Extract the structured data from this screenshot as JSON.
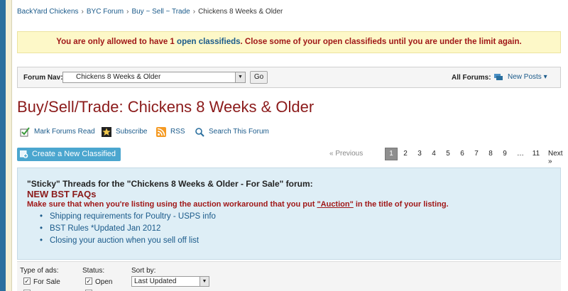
{
  "breadcrumb": {
    "items": [
      "BackYard Chickens",
      "BYC Forum",
      "Buy ~ Sell ~ Trade",
      "Chickens 8 Weeks & Older"
    ],
    "separator": "›"
  },
  "notice": {
    "prefix": "You are only allowed to have 1",
    "link": "open classifieds",
    "suffix": ". Close some of your open classifieds until you are under the limit again."
  },
  "forum_nav": {
    "label": "Forum Nav:",
    "selected": "Chickens 8 Weeks & Older",
    "go_label": "Go",
    "all_forums_label": "All Forums:",
    "new_posts_label": "New Posts"
  },
  "page_title": "Buy/Sell/Trade: Chickens 8 Weeks & Older",
  "tools": {
    "mark_read": "Mark Forums Read",
    "subscribe": "Subscribe",
    "rss": "RSS",
    "search": "Search This Forum"
  },
  "create_button": "Create a New Classified",
  "pagination": {
    "previous": "« Previous",
    "pages": [
      "1",
      "2",
      "3",
      "4",
      "5",
      "6",
      "7",
      "8",
      "9"
    ],
    "current": "1",
    "ellipsis": "…",
    "last": "11",
    "next": "Next »"
  },
  "sticky": {
    "header": "\"Sticky\" Threads for the \"Chickens 8 Weeks & Older - For Sale\" forum:",
    "subtitle": "NEW BST FAQs",
    "warning_prefix": "Make sure that when you're listing using the auction workaround that you put ",
    "warning_link": "\"Auction\"",
    "warning_suffix": " in the title of your listing.",
    "links": [
      "Shipping requirements for Poultry - USPS info",
      "BST Rules *Updated Jan 2012",
      "Closing your auction when you sell off list"
    ],
    "bullet": "•"
  },
  "filters": {
    "type_label": "Type of ads:",
    "status_label": "Status:",
    "sort_label": "Sort by:",
    "type_option": "For Sale",
    "status_option": "Open",
    "sort_value": "Last Updated",
    "check_mark": "✓"
  },
  "colors": {
    "accent_blue": "#1a5a8a",
    "title_red": "#8b1a1a",
    "notice_bg": "#fdf8c8",
    "sticky_bg": "#deeef6",
    "button_blue": "#4ba6cf"
  }
}
